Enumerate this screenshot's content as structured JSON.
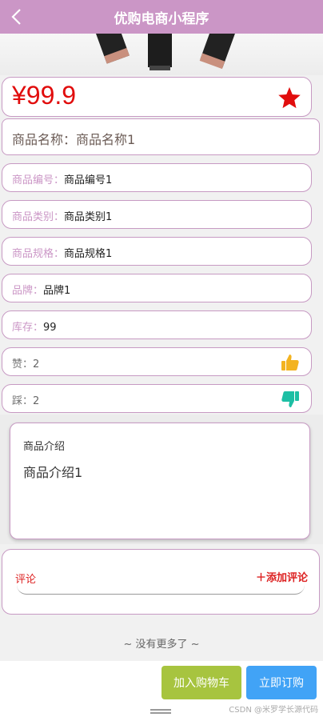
{
  "navbar": {
    "title": "优购电商小程序",
    "back_icon": "chevron-left-icon"
  },
  "product": {
    "price": "¥99.9",
    "favorite_icon": "star-icon",
    "favorite_color": "#e10d0d",
    "name_label": "商品名称：",
    "name_value": "商品名称1"
  },
  "fields": [
    {
      "label": "商品编号：",
      "value": "商品编号1"
    },
    {
      "label": "商品类别：",
      "value": "商品类别1"
    },
    {
      "label": "商品规格：",
      "value": "商品规格1"
    },
    {
      "label": "品牌：",
      "value": "品牌1"
    },
    {
      "label": "库存：",
      "value": "99"
    }
  ],
  "votes": {
    "like_label": "赞：",
    "like_value": "2",
    "like_icon": "thumbs-up-icon",
    "dislike_label": "踩：",
    "dislike_value": "2",
    "dislike_icon": "thumbs-down-icon"
  },
  "intro": {
    "heading": "商品介绍",
    "content": "商品介绍1"
  },
  "comments": {
    "heading": "评论",
    "add_label": "＋添加评论"
  },
  "footer": {
    "more": "~ 没有更多了 ~"
  },
  "actions": {
    "add_to_cart": "加入购物车",
    "buy_now": "立即订购",
    "cart_color": "#a7c43f",
    "buy_color": "#41a3f6"
  },
  "watermark": "CSDN @米罗学长源代码"
}
